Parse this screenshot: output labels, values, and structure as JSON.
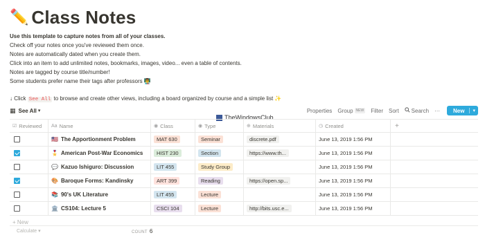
{
  "page": {
    "title_emoji": "✏️",
    "title": "Class Notes",
    "intro_bold": "Use this template to capture notes from all of your classes.",
    "lines": [
      "Check off your notes once you've reviewed them once.",
      "Notes are automatically dated when you create them.",
      "Click into an item to add unlimited notes, bookmarks, images, video... even a table of contents.",
      "Notes are tagged by course title/number!",
      "Some students prefer name their tags after professors 👨‍🏫"
    ],
    "tip_prefix": "↓ Click",
    "tip_code": "See All",
    "tip_suffix": "to browse and create other views, including a board organized by course and a simple list ✨"
  },
  "toolbar": {
    "view_icon": "table-icon",
    "view_label": "See All",
    "view_arrow": "▾",
    "properties": "Properties",
    "group": "Group",
    "group_badge": "NEW",
    "filter": "Filter",
    "sort": "Sort",
    "search_icon": "search-icon",
    "search": "Search",
    "more": "···",
    "new_label": "New",
    "new_arrow": "▾"
  },
  "watermark": "TheWindowsClub",
  "columns": [
    {
      "label": "Reviewed",
      "icon": "checkbox-icon",
      "glyph": "☑"
    },
    {
      "label": "Name",
      "icon": "text-icon",
      "glyph": "Aa"
    },
    {
      "label": "Class",
      "icon": "select-icon",
      "glyph": "◉"
    },
    {
      "label": "Type",
      "icon": "select-icon",
      "glyph": "◉"
    },
    {
      "label": "Materials",
      "icon": "link-icon",
      "glyph": "⊕"
    },
    {
      "label": "Created",
      "icon": "clock-icon",
      "glyph": "◷"
    }
  ],
  "add_column": "+",
  "rows": [
    {
      "reviewed": false,
      "emoji": "🇺🇸",
      "name": "The Apportionment Problem",
      "class": "MAT 630",
      "class_color": "#fbe1d6",
      "type": "Seminar",
      "type_color": "#fbe1d6",
      "materials": "discrete.pdf",
      "created": "June 13, 2019 1:56 PM"
    },
    {
      "reviewed": true,
      "emoji": "🎖️",
      "name": "American Post-War Economics",
      "class": "HIST 230",
      "class_color": "#dbeddb",
      "type": "Section",
      "type_color": "#d3e5ef",
      "materials": "https://www.th...",
      "created": "June 13, 2019 1:56 PM"
    },
    {
      "reviewed": false,
      "emoji": "💬",
      "name": "Kazuo Ishiguro: Discussion",
      "class": "LIT 455",
      "class_color": "#d3e5ef",
      "type": "Study Group",
      "type_color": "#fdecc8",
      "materials": "",
      "created": "June 13, 2019 1:56 PM"
    },
    {
      "reviewed": true,
      "emoji": "🎨",
      "name": "Baroque Forms: Kandinsky",
      "class": "ART 399",
      "class_color": "#ffe2dd",
      "type": "Reading",
      "type_color": "#e8deee",
      "materials": "https://open.sp...",
      "created": "June 13, 2019 1:56 PM"
    },
    {
      "reviewed": false,
      "emoji": "📚",
      "name": "90's UK Literature",
      "class": "LIT 455",
      "class_color": "#d3e5ef",
      "type": "Lecture",
      "type_color": "#fbe1d6",
      "materials": "",
      "created": "June 13, 2019 1:56 PM"
    },
    {
      "reviewed": false,
      "emoji": "🏛️",
      "name": "CS104: Lecture 5",
      "class": "CSCI 104",
      "class_color": "#e8deee",
      "type": "Lecture",
      "type_color": "#fbe1d6",
      "materials": "http://bits.usc.e...",
      "created": "June 13, 2019 1:56 PM"
    }
  ],
  "new_row": "+ New",
  "footer": {
    "calculate": "Calculate",
    "calculate_arrow": "▾",
    "count_label": "COUNT",
    "count_value": "6"
  }
}
